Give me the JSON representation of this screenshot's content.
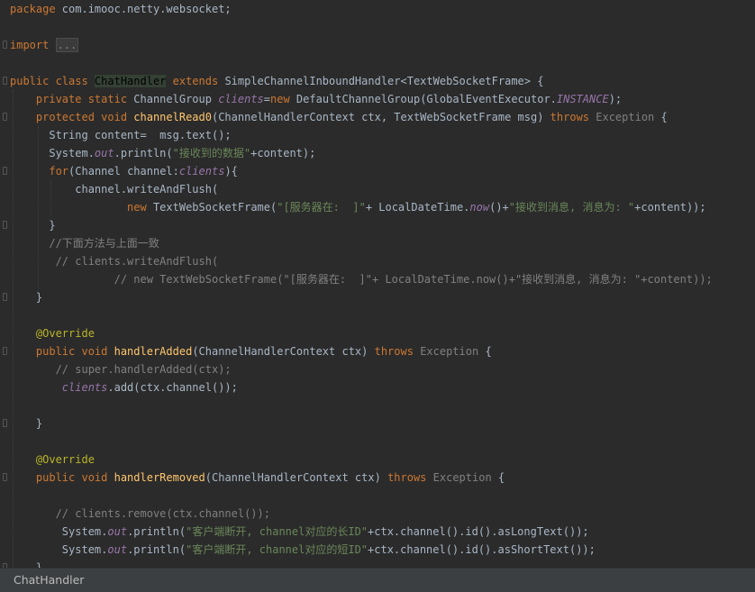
{
  "editor": {
    "lines": [
      {
        "tokens": [
          {
            "c": "k",
            "t": "package "
          },
          {
            "c": "t",
            "t": "com.imooc.netty.websocket;"
          }
        ]
      },
      {
        "tokens": []
      },
      {
        "tokens": [
          {
            "c": "k",
            "t": "import "
          },
          {
            "c": "fold",
            "t": "..."
          }
        ]
      },
      {
        "tokens": []
      },
      {
        "tokens": [
          {
            "c": "k",
            "t": "public class "
          },
          {
            "c": "hl",
            "t": "ChatHandler"
          },
          {
            "c": "k",
            "t": " extends "
          },
          {
            "c": "t",
            "t": "SimpleChannelInboundHandler<TextWebSocketFrame> {"
          }
        ]
      },
      {
        "tokens": [
          {
            "c": "t",
            "t": "    "
          },
          {
            "c": "k",
            "t": "private static "
          },
          {
            "c": "t",
            "t": "ChannelGroup "
          },
          {
            "c": "p",
            "t": "clients"
          },
          {
            "c": "t",
            "t": "="
          },
          {
            "c": "k",
            "t": "new "
          },
          {
            "c": "t",
            "t": "DefaultChannelGroup(GlobalEventExecutor."
          },
          {
            "c": "p",
            "t": "INSTANCE"
          },
          {
            "c": "t",
            "t": ");"
          }
        ]
      },
      {
        "tokens": [
          {
            "c": "t",
            "t": "    "
          },
          {
            "c": "k",
            "t": "protected void "
          },
          {
            "c": "f",
            "t": "channelRead0"
          },
          {
            "c": "t",
            "t": "(ChannelHandlerContext ctx, TextWebSocketFrame msg) "
          },
          {
            "c": "k",
            "t": "throws "
          },
          {
            "c": "g",
            "t": "Exception"
          },
          {
            "c": "t",
            "t": " {"
          }
        ]
      },
      {
        "tokens": [
          {
            "c": "t",
            "t": "      String content=  msg.text();"
          }
        ]
      },
      {
        "tokens": [
          {
            "c": "t",
            "t": "      System."
          },
          {
            "c": "p",
            "t": "out"
          },
          {
            "c": "t",
            "t": ".println("
          },
          {
            "c": "s",
            "t": "\"接收到的数据\""
          },
          {
            "c": "t",
            "t": "+content);"
          }
        ]
      },
      {
        "tokens": [
          {
            "c": "t",
            "t": "      "
          },
          {
            "c": "k",
            "t": "for"
          },
          {
            "c": "t",
            "t": "(Channel channel:"
          },
          {
            "c": "p",
            "t": "clients"
          },
          {
            "c": "t",
            "t": "){"
          }
        ]
      },
      {
        "tokens": [
          {
            "c": "t",
            "t": "          channel.writeAndFlush("
          }
        ]
      },
      {
        "tokens": [
          {
            "c": "t",
            "t": "                  "
          },
          {
            "c": "k",
            "t": "new "
          },
          {
            "c": "t",
            "t": "TextWebSocketFrame("
          },
          {
            "c": "s",
            "t": "\"[服务器在:  ]\""
          },
          {
            "c": "t",
            "t": "+ LocalDateTime."
          },
          {
            "c": "p",
            "t": "now"
          },
          {
            "c": "t",
            "t": "()+"
          },
          {
            "c": "s",
            "t": "\"接收到消息, 消息为: \""
          },
          {
            "c": "t",
            "t": "+content));"
          }
        ]
      },
      {
        "tokens": [
          {
            "c": "t",
            "t": "      }"
          }
        ]
      },
      {
        "tokens": [
          {
            "c": "c",
            "t": "      //下面方法与上面一致"
          }
        ]
      },
      {
        "tokens": [
          {
            "c": "c",
            "t": "       // clients.writeAndFlush("
          }
        ]
      },
      {
        "tokens": [
          {
            "c": "c",
            "t": "                // new TextWebSocketFrame(\"[服务器在:  ]\"+ LocalDateTime.now()+\"接收到消息, 消息为: \"+content));"
          }
        ]
      },
      {
        "tokens": [
          {
            "c": "t",
            "t": "    }"
          }
        ]
      },
      {
        "tokens": []
      },
      {
        "tokens": [
          {
            "c": "a",
            "t": "    @Override"
          }
        ]
      },
      {
        "tokens": [
          {
            "c": "t",
            "t": "    "
          },
          {
            "c": "k",
            "t": "public void "
          },
          {
            "c": "f",
            "t": "handlerAdded"
          },
          {
            "c": "t",
            "t": "(ChannelHandlerContext ctx) "
          },
          {
            "c": "k",
            "t": "throws "
          },
          {
            "c": "g",
            "t": "Exception"
          },
          {
            "c": "t",
            "t": " {"
          }
        ]
      },
      {
        "tokens": [
          {
            "c": "c",
            "t": "       // super.handlerAdded(ctx);"
          }
        ]
      },
      {
        "tokens": [
          {
            "c": "t",
            "t": "        "
          },
          {
            "c": "p",
            "t": "clients"
          },
          {
            "c": "t",
            "t": ".add(ctx.channel());"
          }
        ]
      },
      {
        "tokens": []
      },
      {
        "tokens": [
          {
            "c": "t",
            "t": "    }"
          }
        ]
      },
      {
        "tokens": []
      },
      {
        "tokens": [
          {
            "c": "a",
            "t": "    @Override"
          }
        ]
      },
      {
        "tokens": [
          {
            "c": "t",
            "t": "    "
          },
          {
            "c": "k",
            "t": "public void "
          },
          {
            "c": "f",
            "t": "handlerRemoved"
          },
          {
            "c": "t",
            "t": "(ChannelHandlerContext ctx) "
          },
          {
            "c": "k",
            "t": "throws "
          },
          {
            "c": "g",
            "t": "Exception"
          },
          {
            "c": "t",
            "t": " {"
          }
        ]
      },
      {
        "tokens": []
      },
      {
        "tokens": [
          {
            "c": "c",
            "t": "       // clients.remove(ctx.channel());"
          }
        ]
      },
      {
        "tokens": [
          {
            "c": "t",
            "t": "        System."
          },
          {
            "c": "p",
            "t": "out"
          },
          {
            "c": "t",
            "t": ".println("
          },
          {
            "c": "s",
            "t": "\"客户端断开, channel对应的长ID\""
          },
          {
            "c": "t",
            "t": "+ctx.channel().id().asLongText());"
          }
        ]
      },
      {
        "tokens": [
          {
            "c": "t",
            "t": "        System."
          },
          {
            "c": "p",
            "t": "out"
          },
          {
            "c": "t",
            "t": ".println("
          },
          {
            "c": "s",
            "t": "\"客户端断开, channel对应的短ID\""
          },
          {
            "c": "t",
            "t": "+ctx.channel().id().asShortText());"
          }
        ]
      },
      {
        "tokens": [
          {
            "c": "t",
            "t": "    }"
          }
        ]
      }
    ]
  },
  "status_bar": {
    "breadcrumb": "ChatHandler"
  },
  "colors": {
    "background": "#2b2b2b",
    "keyword": "#cc7832",
    "text": "#a9b7c6",
    "string": "#6a8759",
    "comment": "#808080",
    "method": "#ffc66d",
    "field": "#9876aa",
    "annotation": "#bbb529"
  }
}
